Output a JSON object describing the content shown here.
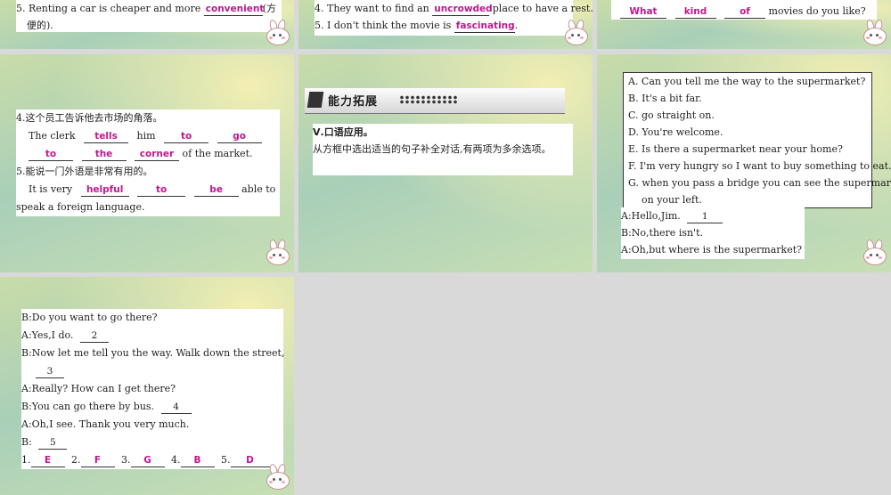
{
  "slide1": {
    "q5_text": "5. Renting a car is cheaper and more",
    "q5_answer": "convenient",
    "q5_tail": "(方",
    "q5_line2": "便的)."
  },
  "slide2": {
    "q4_text": "4. They want to find an",
    "q4_answer": "uncrowded",
    "q4_tail": "place to have a rest.",
    "q5_text": "5. I don't think the movie is",
    "q5_answer": "fascinating",
    "q5_tail": "."
  },
  "slide3": {
    "answers": [
      "What",
      "kind",
      "of"
    ],
    "tail": "movies do you like?"
  },
  "slide4": {
    "q4_cn": "4.这个员工告诉他去市场的角落。",
    "l1_a": "The clerk",
    "l1_ans1": "tells",
    "l1_b": "him",
    "l1_ans2": "to",
    "l1_ans3": "go",
    "l2_ans1": "to",
    "l2_ans2": "the",
    "l2_ans3": "corner",
    "l2_tail": "of the market.",
    "q5_cn": "5.能说一门外语是非常有用的。",
    "l3_a": "It is very",
    "l3_ans1": "helpful",
    "l3_ans2": "to",
    "l3_ans3": "be",
    "l3_tail": "able to",
    "l4": "speak a foreign language."
  },
  "slide5": {
    "header": "能力拓展",
    "section": "Ⅴ.口语应用。",
    "instruction": "从方框中选出适当的句子补全对话,有两项为多余选项。"
  },
  "slide6": {
    "options": [
      "A. Can you tell me the way to the supermarket?",
      "B. It's a bit far.",
      "C. go straight on.",
      "D. You're welcome.",
      "E. Is there a supermarket near your home?",
      "F. I'm very hungry so I want to buy something to eat.",
      "G. when you pass a bridge you can see the supermarket",
      "on your left."
    ],
    "d1": "A:Hello,Jim.",
    "b1": "1",
    "d2": "B:No,there isn't.",
    "d3": "A:Oh,but where is the supermarket?"
  },
  "slide7": {
    "d1": "B:Do you want to go there?",
    "d2": "A:Yes,I do.",
    "b2": "2",
    "d3": "B:Now let me tell you the way. Walk down the street,",
    "b3": "3",
    "d4": "A:Really? How can I get there?",
    "d5": "B:You can go there by bus.",
    "b4": "4",
    "d6": "A:Oh,I see. Thank you very much.",
    "d7": "B:",
    "b5": "5",
    "key_nums": [
      "1.",
      "2.",
      "3.",
      "4.",
      "5."
    ],
    "key_ans": [
      "E",
      "F",
      "G",
      "B",
      "D"
    ]
  },
  "colors": {
    "answer": "#c0178f",
    "background": "#d9d9d9"
  }
}
